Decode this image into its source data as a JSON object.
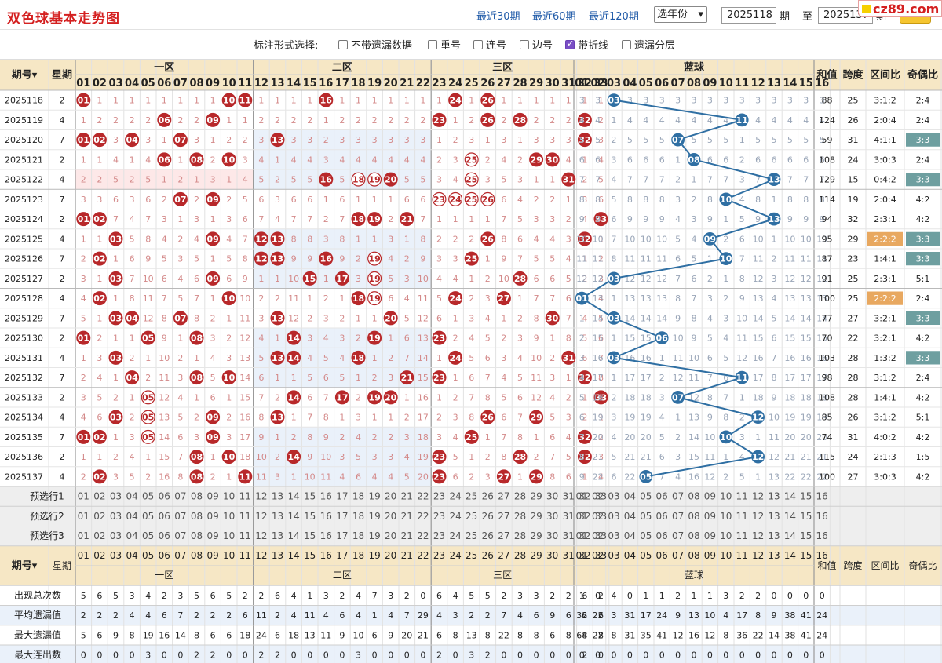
{
  "header": {
    "title": "双色球基本走势图",
    "nav": [
      "最近30期",
      "最近60期",
      "最近120期"
    ],
    "year_select": "选年份",
    "from_value": "2025118",
    "from_unit": "期",
    "to_label": "至",
    "to_value": "2025137",
    "to_unit": "期",
    "logo": "cz89.com"
  },
  "options": {
    "label": "标注形式选择:",
    "items": [
      {
        "label": "不带遗漏数据",
        "checked": false
      },
      {
        "label": "重号",
        "checked": false
      },
      {
        "label": "连号",
        "checked": false
      },
      {
        "label": "边号",
        "checked": false
      },
      {
        "label": "带折线",
        "checked": true
      },
      {
        "label": "遗漏分层",
        "checked": false
      }
    ]
  },
  "table": {
    "col_issue": "期号",
    "col_week": "星期",
    "zones": [
      "一区",
      "二区",
      "三区"
    ],
    "blue_label": "蓝球",
    "col_sum": "和值",
    "col_span": "跨度",
    "col_ratio": "区间比",
    "col_oe": "奇偶比",
    "rows": [
      {
        "issue": "2025118",
        "week": "2",
        "sum": "88",
        "span": "25",
        "ratio": "3:1:2",
        "oe": "2:4",
        "red": [
          1,
          10,
          11,
          16,
          24,
          26
        ],
        "blue": 3
      },
      {
        "issue": "2025119",
        "week": "4",
        "sum": "124",
        "span": "26",
        "ratio": "2:0:4",
        "oe": "2:4",
        "red": [
          6,
          9,
          23,
          26,
          28,
          32
        ],
        "blue": 11
      },
      {
        "issue": "2025120",
        "week": "7",
        "sum": "59",
        "span": "31",
        "ratio": "4:1:1",
        "oe": "3:3",
        "red": [
          1,
          2,
          4,
          7,
          13,
          32
        ],
        "blue": 7
      },
      {
        "issue": "2025121",
        "week": "2",
        "sum": "108",
        "span": "24",
        "ratio": "3:0:3",
        "oe": "2:4",
        "red": [
          6,
          8,
          10,
          25,
          29,
          30
        ],
        "blue": 8
      },
      {
        "issue": "2025122",
        "week": "4",
        "sum": "129",
        "span": "15",
        "ratio": "0:4:2",
        "oe": "3:3",
        "red": [
          16,
          18,
          19,
          20,
          25,
          31
        ],
        "blue": 13
      },
      {
        "issue": "2025123",
        "week": "7",
        "sum": "114",
        "span": "19",
        "ratio": "2:0:4",
        "oe": "4:2",
        "red": [
          7,
          9,
          23,
          24,
          25,
          26
        ],
        "blue": 10
      },
      {
        "issue": "2025124",
        "week": "2",
        "sum": "94",
        "span": "32",
        "ratio": "2:3:1",
        "oe": "4:2",
        "red": [
          1,
          2,
          18,
          19,
          21,
          33
        ],
        "blue": 13
      },
      {
        "issue": "2025125",
        "week": "4",
        "sum": "95",
        "span": "29",
        "ratio": "2:2:2",
        "oe": "3:3",
        "red": [
          3,
          9,
          12,
          13,
          26,
          32
        ],
        "blue": 9
      },
      {
        "issue": "2025126",
        "week": "7",
        "sum": "87",
        "span": "23",
        "ratio": "1:4:1",
        "oe": "3:3",
        "red": [
          2,
          12,
          13,
          16,
          19,
          25
        ],
        "blue": 10
      },
      {
        "issue": "2025127",
        "week": "2",
        "sum": "91",
        "span": "25",
        "ratio": "2:3:1",
        "oe": "5:1",
        "red": [
          3,
          9,
          15,
          17,
          19,
          28
        ],
        "blue": 3
      },
      {
        "issue": "2025128",
        "week": "4",
        "sum": "100",
        "span": "25",
        "ratio": "2:2:2",
        "oe": "2:4",
        "red": [
          2,
          10,
          18,
          19,
          24,
          27
        ],
        "blue": 1
      },
      {
        "issue": "2025129",
        "week": "7",
        "sum": "77",
        "span": "27",
        "ratio": "3:2:1",
        "oe": "3:3",
        "red": [
          3,
          4,
          7,
          13,
          20,
          30
        ],
        "blue": 3
      },
      {
        "issue": "2025130",
        "week": "2",
        "sum": "70",
        "span": "22",
        "ratio": "3:2:1",
        "oe": "4:2",
        "red": [
          1,
          5,
          8,
          14,
          19,
          23
        ],
        "blue": 6
      },
      {
        "issue": "2025131",
        "week": "4",
        "sum": "103",
        "span": "28",
        "ratio": "1:3:2",
        "oe": "3:3",
        "red": [
          3,
          13,
          14,
          18,
          24,
          31
        ],
        "blue": 3
      },
      {
        "issue": "2025132",
        "week": "7",
        "sum": "98",
        "span": "28",
        "ratio": "3:1:2",
        "oe": "2:4",
        "red": [
          4,
          8,
          10,
          21,
          23,
          32
        ],
        "blue": 11
      },
      {
        "issue": "2025133",
        "week": "2",
        "sum": "108",
        "span": "28",
        "ratio": "1:4:1",
        "oe": "4:2",
        "red": [
          5,
          14,
          17,
          19,
          20,
          33
        ],
        "blue": 7
      },
      {
        "issue": "2025134",
        "week": "4",
        "sum": "85",
        "span": "26",
        "ratio": "3:1:2",
        "oe": "5:1",
        "red": [
          3,
          5,
          9,
          13,
          26,
          29
        ],
        "blue": 12
      },
      {
        "issue": "2025135",
        "week": "7",
        "sum": "74",
        "span": "31",
        "ratio": "4:0:2",
        "oe": "4:2",
        "red": [
          1,
          2,
          5,
          9,
          25,
          32
        ],
        "blue": 10
      },
      {
        "issue": "2025136",
        "week": "2",
        "sum": "115",
        "span": "24",
        "ratio": "2:1:3",
        "oe": "1:5",
        "red": [
          8,
          10,
          14,
          23,
          28,
          32
        ],
        "blue": 12
      },
      {
        "issue": "2025137",
        "week": "4",
        "sum": "100",
        "span": "27",
        "ratio": "3:0:3",
        "oe": "4:2",
        "red": [
          2,
          8,
          11,
          23,
          27,
          29
        ],
        "blue": 5
      }
    ],
    "preselect": [
      "预选行1",
      "预选行2",
      "预选行3"
    ],
    "stats": [
      {
        "label": "出现总次数",
        "red": [
          5,
          6,
          5,
          3,
          4,
          2,
          3,
          5,
          6,
          5,
          2,
          2,
          6,
          4,
          1,
          3,
          2,
          4,
          7,
          3,
          2,
          0,
          6,
          4,
          5,
          5,
          2,
          3,
          3,
          2,
          2,
          6,
          2
        ],
        "blue": [
          1,
          0,
          4,
          0,
          1,
          1,
          2,
          1,
          1,
          3,
          2,
          2,
          0,
          0,
          0,
          0
        ]
      },
      {
        "label": "平均遗漏值",
        "red": [
          2,
          2,
          2,
          4,
          4,
          6,
          7,
          2,
          2,
          2,
          6,
          11,
          2,
          4,
          11,
          4,
          6,
          4,
          1,
          4,
          7,
          29,
          4,
          3,
          2,
          2,
          7,
          4,
          6,
          9,
          6,
          2,
          6
        ],
        "blue": [
          36,
          22,
          3,
          31,
          17,
          24,
          9,
          13,
          10,
          4,
          17,
          8,
          9,
          38,
          41,
          24
        ]
      },
      {
        "label": "最大遗漏值",
        "red": [
          5,
          6,
          9,
          8,
          19,
          16,
          14,
          8,
          6,
          6,
          18,
          24,
          6,
          18,
          13,
          11,
          9,
          10,
          6,
          9,
          20,
          21,
          6,
          8,
          13,
          8,
          22,
          8,
          8,
          6,
          8,
          8,
          8
        ],
        "blue": [
          64,
          22,
          8,
          31,
          35,
          41,
          12,
          16,
          12,
          8,
          36,
          22,
          14,
          38,
          41,
          24
        ]
      },
      {
        "label": "最大连出数",
        "red": [
          0,
          0,
          0,
          0,
          3,
          0,
          0,
          2,
          2,
          0,
          0,
          2,
          2,
          0,
          0,
          0,
          0,
          3,
          0,
          0,
          0,
          0,
          2,
          0,
          3,
          2,
          0,
          0,
          0,
          0,
          0,
          2,
          0
        ],
        "blue": [
          0,
          0,
          0,
          0,
          0,
          0,
          0,
          0,
          0,
          0,
          0,
          0,
          0,
          0,
          0,
          0
        ]
      }
    ]
  },
  "colors": {
    "red_ball": "#b8282a",
    "blue_ball": "#2f6fa3",
    "header_bg": "#f6e7c5",
    "ratio_hi": "#e8a860",
    "oe_hi": "#6e9fa0",
    "red_miss": "#d48a8a",
    "blue_miss": "#9aa6b8"
  }
}
